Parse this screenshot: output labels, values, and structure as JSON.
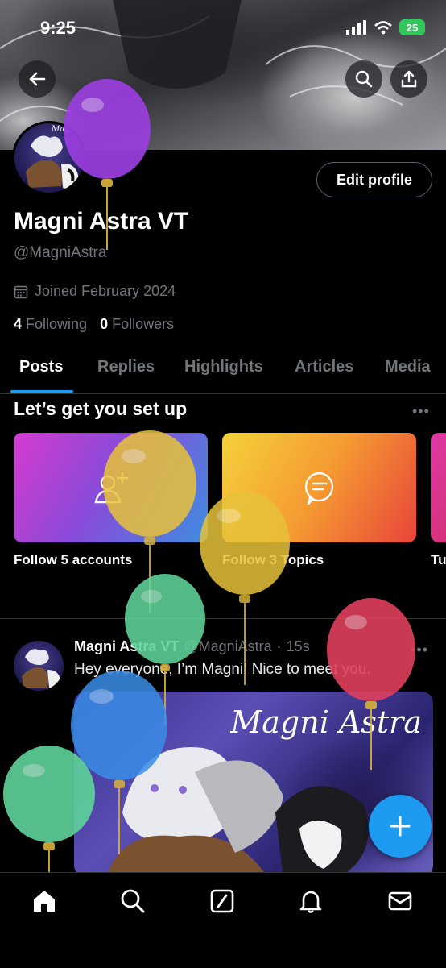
{
  "status_bar": {
    "time": "9:25",
    "battery": "25"
  },
  "profile": {
    "name": "Magni Astra VT",
    "handle": "@MagniAstra",
    "joined": "Joined February 2024",
    "following_count": "4",
    "following_label": "Following",
    "followers_count": "0",
    "followers_label": "Followers",
    "edit_button": "Edit profile",
    "avatar_signature": "Magni"
  },
  "tabs": [
    "Posts",
    "Replies",
    "Highlights",
    "Articles",
    "Media"
  ],
  "setup": {
    "title": "Let’s get you set up",
    "cards": [
      {
        "label": "Follow 5 accounts",
        "icon": "add-user-icon"
      },
      {
        "label": "Follow 3 Topics",
        "icon": "topic-chat-icon"
      },
      {
        "label": "Tu",
        "icon": ""
      }
    ]
  },
  "post": {
    "author_name": "Magni Astra VT",
    "author_handle": "@MagniAstra",
    "separator": "·",
    "time": "15s",
    "text": "Hey everyone, I’m Magni! Nice to meet you.",
    "media_title": "Magni Astra"
  },
  "bottom_nav": [
    "home-icon",
    "search-icon",
    "grok-icon",
    "notifications-icon",
    "messages-icon"
  ],
  "colors": {
    "accent": "#1d9bf0",
    "balloon_purple": "#9b3fe0",
    "balloon_yellow": "#e8c23a",
    "balloon_green": "#5fd39a",
    "balloon_red": "#e0405e",
    "balloon_blue": "#3a8ee8"
  }
}
